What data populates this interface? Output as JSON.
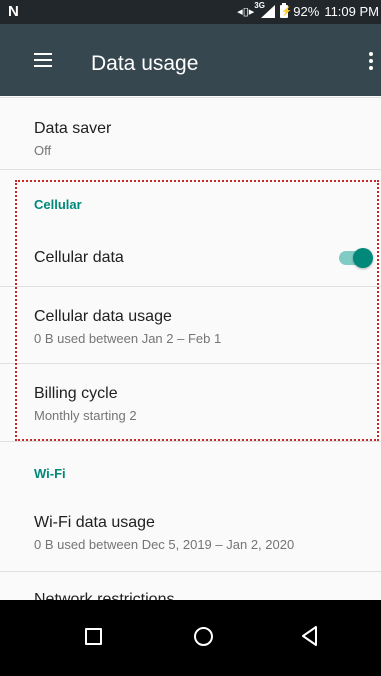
{
  "status_bar": {
    "carrier_icon": "N",
    "network": "3G",
    "battery": "92%",
    "time": "11:09 PM"
  },
  "app_bar": {
    "title": "Data usage",
    "menu_icon": "hamburger-icon",
    "overflow_icon": "more-vert-icon"
  },
  "settings": {
    "data_saver": {
      "title": "Data saver",
      "subtitle": "Off"
    },
    "cellular_header": "Cellular",
    "cellular_data": {
      "title": "Cellular data",
      "enabled": true
    },
    "cellular_data_usage": {
      "title": "Cellular data usage",
      "subtitle": "0 B used between Jan 2 – Feb 1"
    },
    "billing_cycle": {
      "title": "Billing cycle",
      "subtitle": "Monthly starting 2"
    },
    "wifi_header": "Wi-Fi",
    "wifi_data_usage": {
      "title": "Wi-Fi data usage",
      "subtitle": "0 B used between Dec 5, 2019 – Jan 2, 2020"
    },
    "network_restrictions": {
      "title": "Network restrictions"
    }
  },
  "colors": {
    "accent": "#00897b",
    "app_bar": "#37474f",
    "status_bar": "#21272b",
    "highlight": "#c62828"
  }
}
